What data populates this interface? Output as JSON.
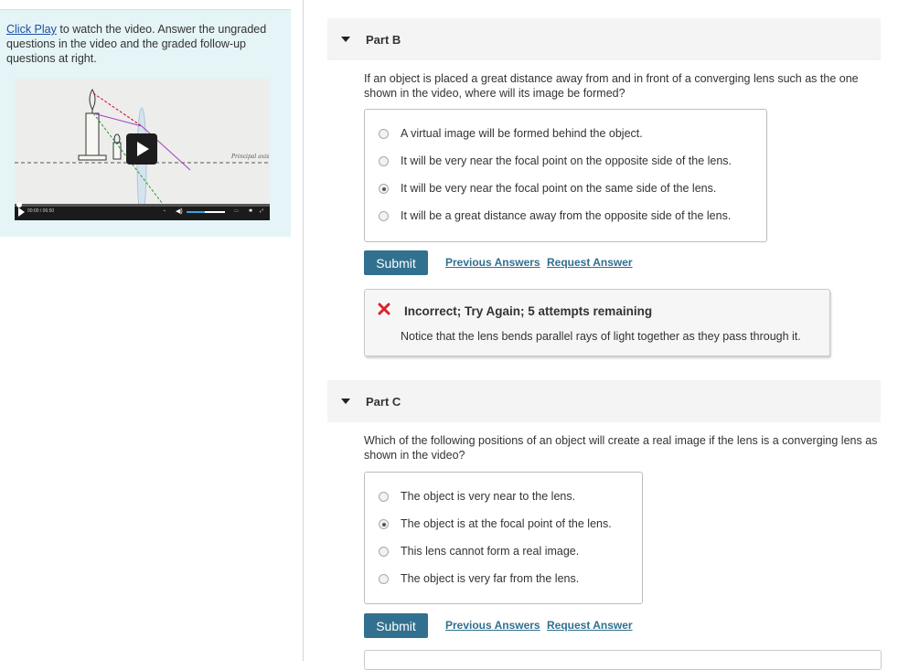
{
  "left": {
    "link_text": "Click Play",
    "intro_rest": " to watch the video. Answer the ungraded questions in the video and the graded follow-up questions at right.",
    "video": {
      "axis_label": "Principal axis",
      "time": "00:00 / 06:50"
    }
  },
  "partB": {
    "title": "Part B",
    "question": "If an object is placed a great distance away from and in front of a converging lens such as the one shown in the video, where will its image be formed?",
    "options": [
      "A virtual image will be formed behind the object.",
      "It will be very near the focal point on the opposite side of the lens.",
      "It will be very near the focal point on the same side of the lens.",
      "It will be a great distance away from the opposite side of the lens."
    ],
    "selected_index": 2,
    "submit": "Submit",
    "prev_answers": "Previous Answers",
    "request_answer": "Request Answer",
    "feedback": {
      "title": "Incorrect; Try Again; 5 attempts remaining",
      "text": "Notice that the lens bends parallel rays of light together as they pass through it."
    }
  },
  "partC": {
    "title": "Part C",
    "question": "Which of the following positions of an object will create a real image if the lens is a converging lens as shown in the video?",
    "options": [
      "The object is very near to the lens.",
      "The object is at the focal point of the lens.",
      "This lens cannot form a real image.",
      "The object is very far from the lens."
    ],
    "selected_index": 1,
    "submit": "Submit",
    "prev_answers": "Previous Answers",
    "request_answer": "Request Answer"
  },
  "colors": {
    "accent": "#31708f",
    "panel": "#e5f4f6",
    "error": "#d9222a"
  },
  "icons": [
    "caret-down-icon",
    "play-icon",
    "incorrect-x-icon",
    "radio-icon"
  ]
}
